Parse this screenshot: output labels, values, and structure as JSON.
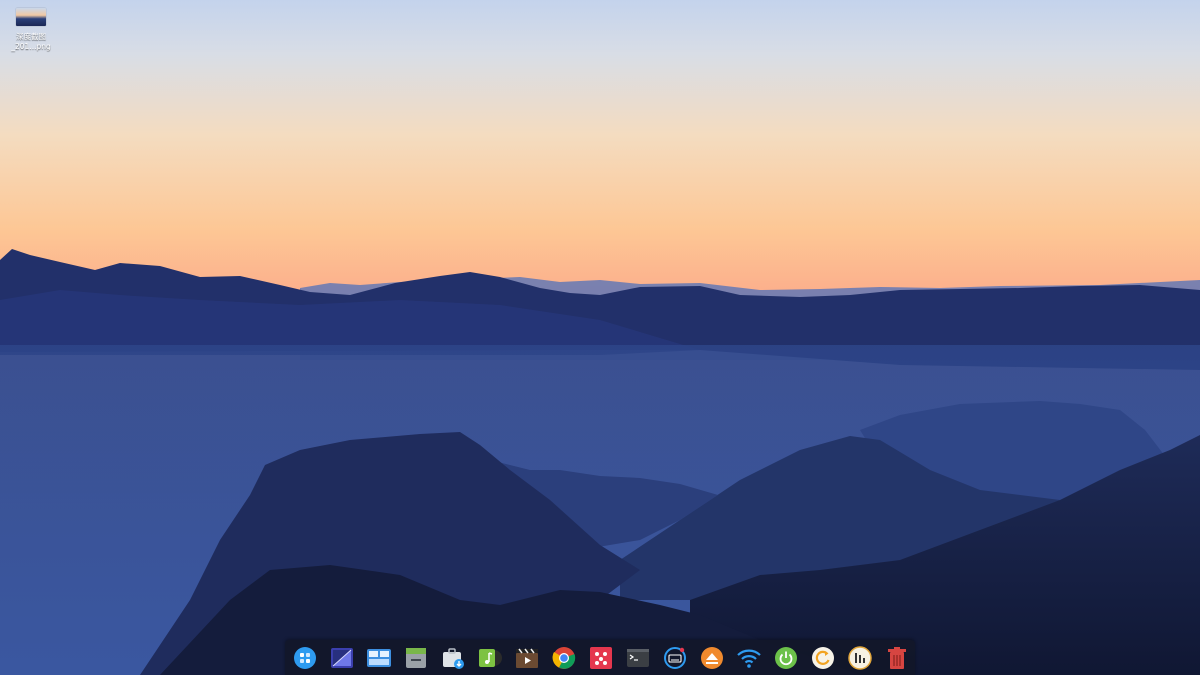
{
  "desktop": {
    "files": [
      {
        "name_line1": "深度截图",
        "name_line2": "_201...png"
      }
    ]
  },
  "dock": {
    "apps": [
      {
        "icon": "launcher-icon"
      },
      {
        "icon": "multitasking-view-icon"
      },
      {
        "icon": "file-manager-icon"
      },
      {
        "icon": "archive-manager-icon"
      },
      {
        "icon": "app-store-icon"
      },
      {
        "icon": "music-player-icon"
      },
      {
        "icon": "movie-player-icon"
      },
      {
        "icon": "chrome-browser-icon"
      },
      {
        "icon": "screen-cast-icon"
      },
      {
        "icon": "terminal-icon"
      },
      {
        "icon": "input-method-icon"
      },
      {
        "icon": "eject-drive-icon"
      },
      {
        "icon": "wifi-icon"
      },
      {
        "icon": "power-icon"
      },
      {
        "icon": "update-icon"
      },
      {
        "icon": "clock-icon"
      },
      {
        "icon": "trash-icon"
      }
    ]
  },
  "colors": {
    "sky_top": "#c4d3ec",
    "sky_horizon": "#fdb689",
    "mist": "#3b5296",
    "dock_bg": "#121626"
  }
}
